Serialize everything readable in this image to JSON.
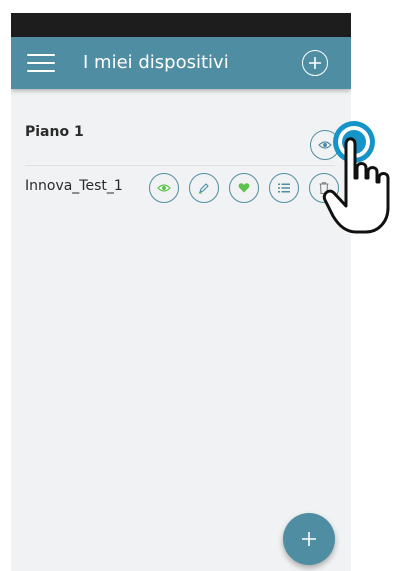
{
  "header": {
    "title": "I miei dispositivi",
    "menu_icon": "hamburger-menu-icon",
    "add_icon": "plus-circle-icon"
  },
  "list": {
    "group": {
      "label": "Piano 1",
      "actions": [
        "eye-icon"
      ]
    },
    "devices": [
      {
        "label": "Innova_Test_1",
        "actions": [
          "eye-icon",
          "pencil-icon",
          "heart-icon",
          "list-icon",
          "trash-icon"
        ]
      }
    ]
  },
  "fab": {
    "icon": "plus-icon"
  },
  "overlay": {
    "icon": "tap-gesture-hand-icon"
  },
  "colors": {
    "app_bar": "#4f8ea2",
    "accent_green": "#5cc24b",
    "background": "#f1f2f3",
    "status_bar": "#1d1d1d",
    "tap_highlight": "#1594c9"
  }
}
